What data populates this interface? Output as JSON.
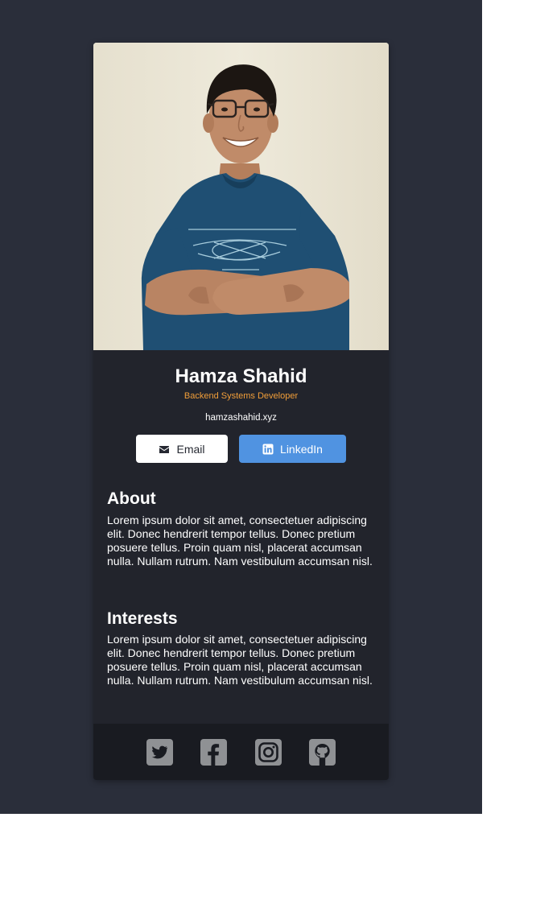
{
  "profile": {
    "photo_alt": "Profile photo",
    "name": "Hamza Shahid",
    "title": "Backend Systems Developer",
    "website": "hamzashahid.xyz"
  },
  "buttons": {
    "email_label": "Email",
    "email_icon": "envelope-icon",
    "linkedin_label": "LinkedIn",
    "linkedin_icon": "linkedin-icon"
  },
  "about": {
    "heading": "About",
    "text": "Lorem ipsum dolor sit amet, consectetuer adipiscing elit. Donec hendrerit tempor tellus. Donec pretium posuere tellus. Proin quam nisl, placerat accumsan nulla. Nullam rutrum. Nam vestibulum accumsan nisl."
  },
  "interests": {
    "heading": "Interests",
    "text": "Lorem ipsum dolor sit amet, consectetuer adipiscing elit. Donec hendrerit tempor tellus. Donec pretium posuere tellus. Proin quam nisl, placerat accumsan nulla. Nullam rutrum. Nam vestibulum accumsan nisl."
  },
  "footer": {
    "social_icons": [
      "twitter-icon",
      "facebook-icon",
      "instagram-icon",
      "github-icon"
    ]
  },
  "colors": {
    "page_background": "#2a2e3a",
    "card_background": "#22242c",
    "footer_background": "#191b21",
    "accent_title": "#f19e39",
    "linkedin_button": "#5093e1",
    "email_button": "#ffffff",
    "social_icon": "#8f9194"
  }
}
